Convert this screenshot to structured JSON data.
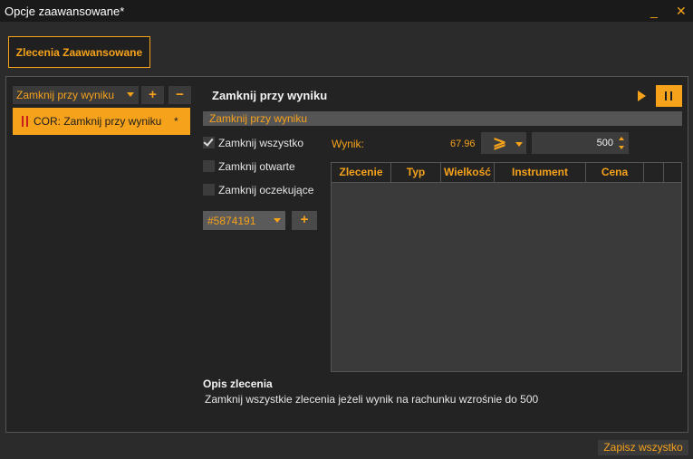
{
  "window": {
    "title": "Opcje zaawansowane*",
    "minimize_label": "_",
    "close_label": "✕"
  },
  "tab": {
    "label": "Zlecenia Zaawansowane"
  },
  "left": {
    "select_value": "Zamknij przy wyniku",
    "add_label": "+",
    "remove_label": "−",
    "items": [
      {
        "label": "COR: Zamknij przy wyniku",
        "modified": "*"
      }
    ]
  },
  "right": {
    "heading": "Zamknij przy wyniku",
    "section_title": "Zamknij przy wyniku",
    "checkboxes": [
      {
        "label": "Zamknij wszystko",
        "checked": true
      },
      {
        "label": "Zamknij otwarte",
        "checked": false
      },
      {
        "label": "Zamknij oczekujące",
        "checked": false
      }
    ],
    "order_select": "#5874191",
    "order_add": "+",
    "wynik_label": "Wynik:",
    "wynik_value": "67.96",
    "operator": "⩾",
    "threshold": "500",
    "table": {
      "columns": [
        "Zlecenie",
        "Typ",
        "Wielkość",
        "Instrument",
        "Cena",
        "",
        ""
      ],
      "rows": []
    },
    "description_title": "Opis zlecenia",
    "description": "Zamknij wszystkie zlecenia jeżeli wynik na rachunku wzrośnie do 500"
  },
  "footer": {
    "save_label": "Zapisz wszystko"
  },
  "colors": {
    "accent": "#f7a21b",
    "background": "#2b2b2b",
    "panel": "#232323"
  }
}
